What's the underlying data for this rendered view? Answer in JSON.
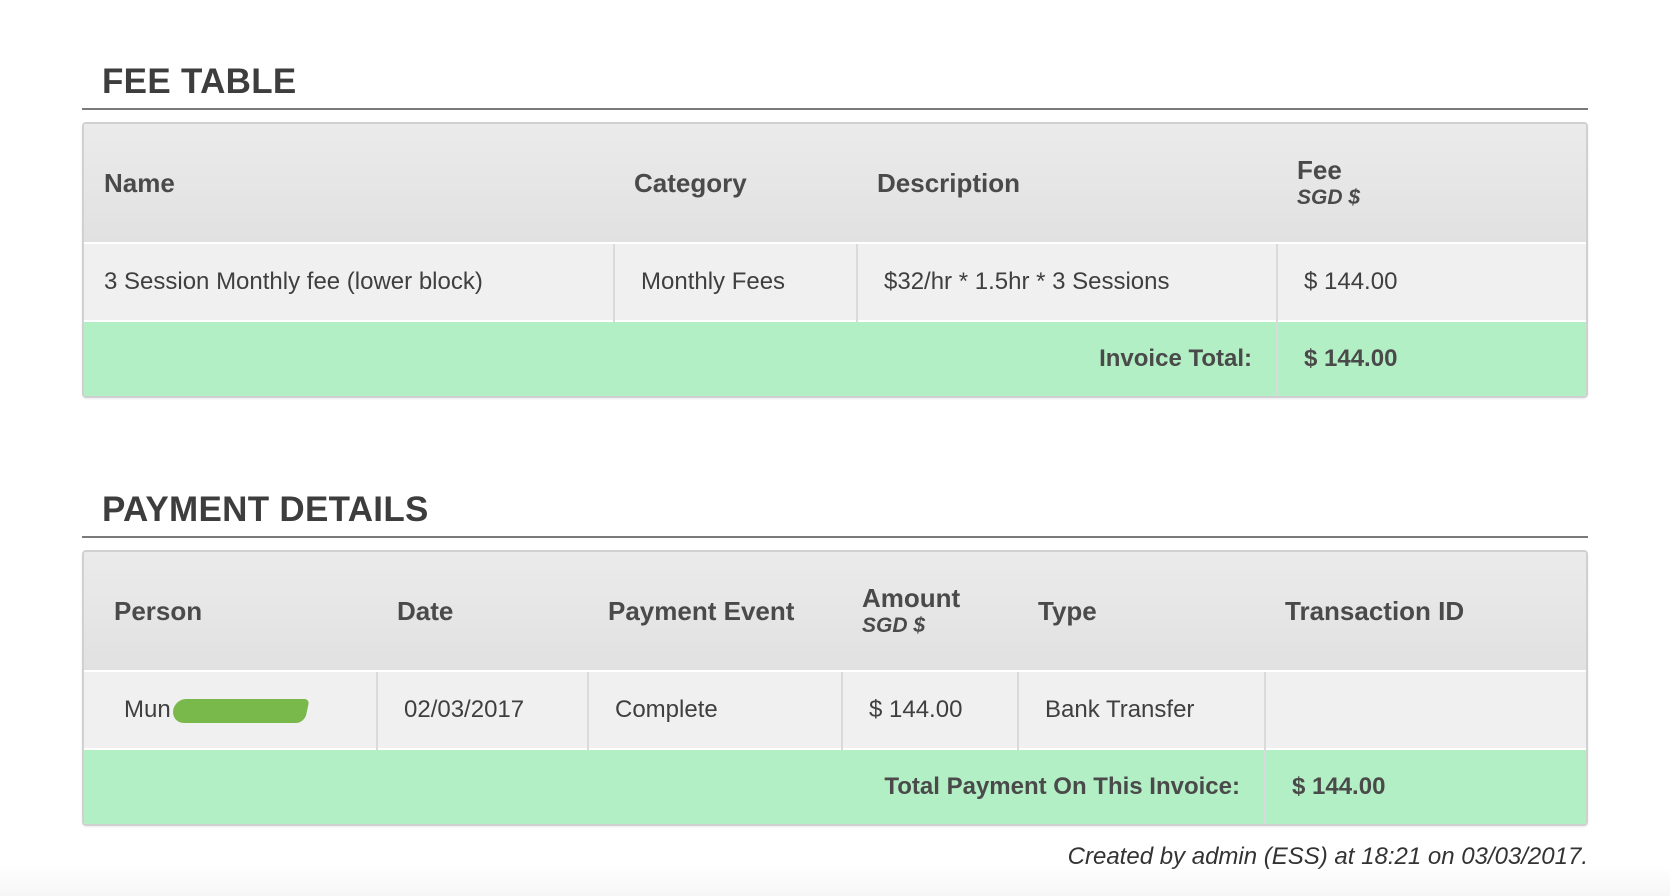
{
  "fee_section": {
    "title": "FEE TABLE",
    "headers": {
      "name": "Name",
      "category": "Category",
      "description": "Description",
      "fee": "Fee",
      "fee_unit": "SGD $"
    },
    "rows": [
      {
        "name": "3 Session Monthly fee (lower block)",
        "category": "Monthly Fees",
        "description": "$32/hr * 1.5hr * 3 Sessions",
        "fee": "$ 144.00"
      }
    ],
    "total_label": "Invoice Total:",
    "total_value": "$ 144.00"
  },
  "payment_section": {
    "title": "PAYMENT DETAILS",
    "headers": {
      "person": "Person",
      "date": "Date",
      "payment_event": "Payment Event",
      "amount": "Amount",
      "amount_unit": "SGD $",
      "type": "Type",
      "transaction_id": "Transaction ID"
    },
    "rows": [
      {
        "person": "Mun",
        "date": "02/03/2017",
        "payment_event": "Complete",
        "amount": "$ 144.00",
        "type": "Bank Transfer",
        "transaction_id": ""
      }
    ],
    "total_label": "Total Payment On This Invoice:",
    "total_value": "$ 144.00"
  },
  "footer": {
    "created_note": "Created by admin (ESS) at 18:21 on 03/03/2017."
  },
  "colors": {
    "total_row_bg": "#b3efc5",
    "header_bg": "#e5e5e5",
    "cell_bg": "#f0f0f0",
    "redaction": "#79b84a"
  }
}
